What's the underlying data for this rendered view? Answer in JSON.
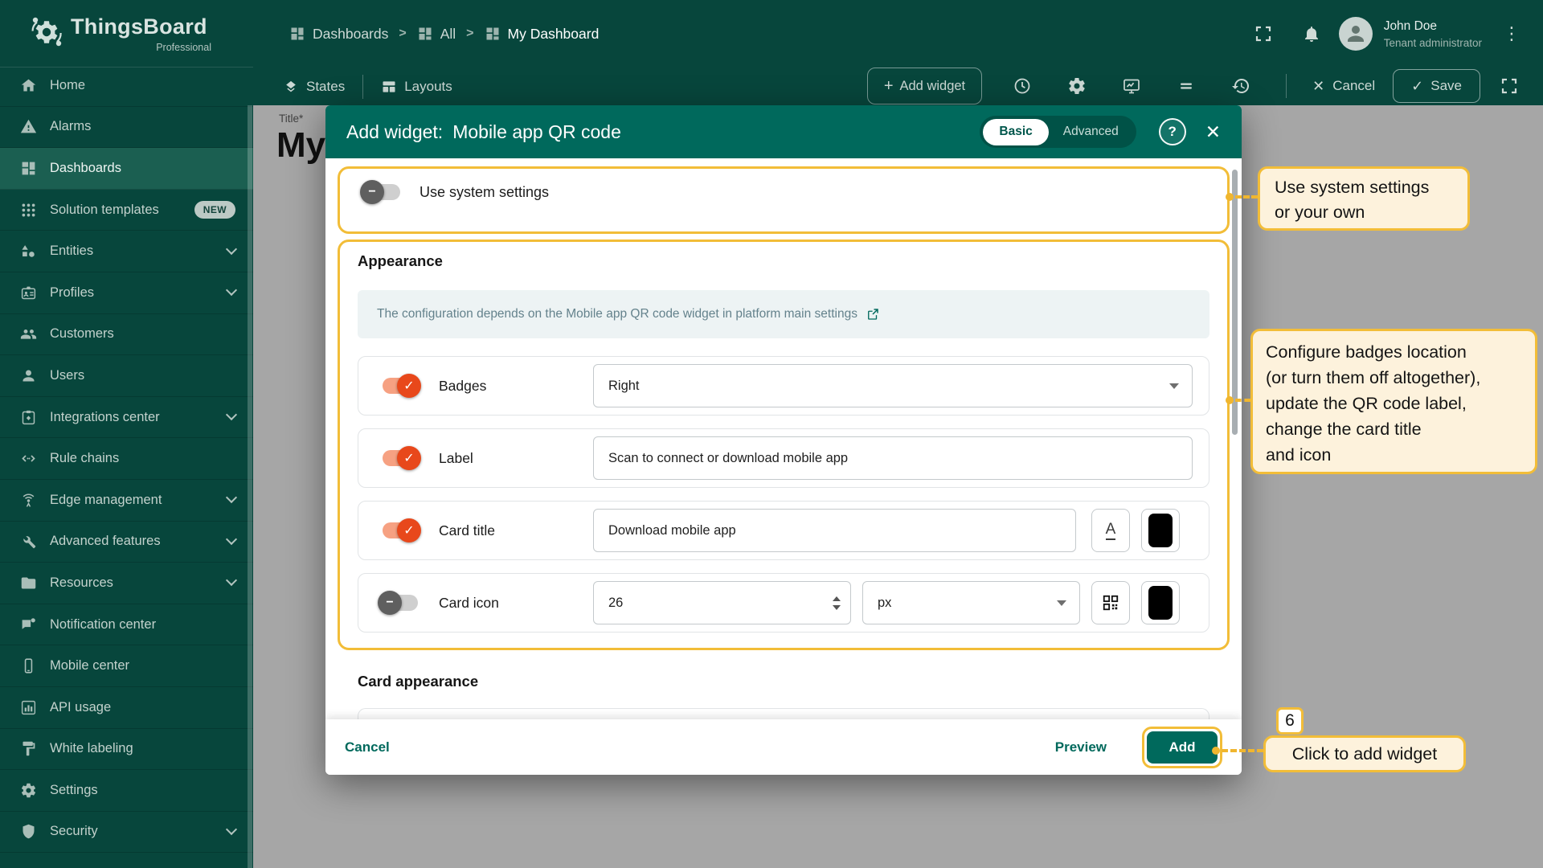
{
  "chrome": {
    "logo_title": "ThingsBoard",
    "logo_subtitle": "Professional",
    "breadcrumb": {
      "level1": "Dashboards",
      "level2": "All",
      "level3": "My Dashboard",
      "separator": ">"
    },
    "user": {
      "name": "John Doe",
      "role": "Tenant administrator"
    },
    "toolbar": {
      "states": "States",
      "layouts": "Layouts",
      "add_widget": "Add widget",
      "cancel": "Cancel",
      "save": "Save"
    }
  },
  "glyphs": {
    "plus": "+",
    "close": "✕",
    "check": "✓",
    "minus": "−",
    "dots": "⋮",
    "help": "?",
    "font": "A"
  },
  "sidebar": {
    "items": [
      {
        "label": "Home"
      },
      {
        "label": "Alarms"
      },
      {
        "label": "Dashboards"
      },
      {
        "label": "Solution templates",
        "badge": "NEW"
      },
      {
        "label": "Entities"
      },
      {
        "label": "Profiles"
      },
      {
        "label": "Customers"
      },
      {
        "label": "Users"
      },
      {
        "label": "Integrations center"
      },
      {
        "label": "Rule chains"
      },
      {
        "label": "Edge management"
      },
      {
        "label": "Advanced features"
      },
      {
        "label": "Resources"
      },
      {
        "label": "Notification center"
      },
      {
        "label": "Mobile center"
      },
      {
        "label": "API usage"
      },
      {
        "label": "White labeling"
      },
      {
        "label": "Settings"
      },
      {
        "label": "Security"
      }
    ]
  },
  "canvas": {
    "title_label": "Title*",
    "title_value": "My"
  },
  "dialog": {
    "title": "Add widget:",
    "widget_name": "Mobile app QR code",
    "tab_basic": "Basic",
    "tab_advanced": "Advanced",
    "use_system_settings": "Use system settings",
    "appearance_heading": "Appearance",
    "hint_text": "The configuration depends on the Mobile app QR code widget in platform main settings",
    "badges_label": "Badges",
    "badges_value": "Right",
    "label_label": "Label",
    "label_value": "Scan to connect or download mobile app",
    "card_title_label": "Card title",
    "card_title_value": "Download mobile app",
    "card_icon_label": "Card icon",
    "card_icon_size": "26",
    "card_icon_unit": "px",
    "card_appearance_heading": "Card appearance",
    "cancel": "Cancel",
    "preview": "Preview",
    "add": "Add"
  },
  "annotations": {
    "step_number": "6",
    "callout_system": {
      "line1": "Use system settings",
      "line2": "or your own"
    },
    "callout_configure": {
      "line1": "Configure badges location",
      "line2": "(or turn them off altogether),",
      "line3": "update the QR code label,",
      "line4": "change the card title",
      "line5": "and icon"
    },
    "callout_add": "Click to add widget"
  },
  "colors": {
    "chrome_green": "#07463c",
    "active_item_green": "#1b5f51",
    "modal_teal": "#00695c",
    "toggle_orange": "#e8481b",
    "annotation_amber": "#f2bd38",
    "annotation_cream": "#fdf2dc"
  }
}
